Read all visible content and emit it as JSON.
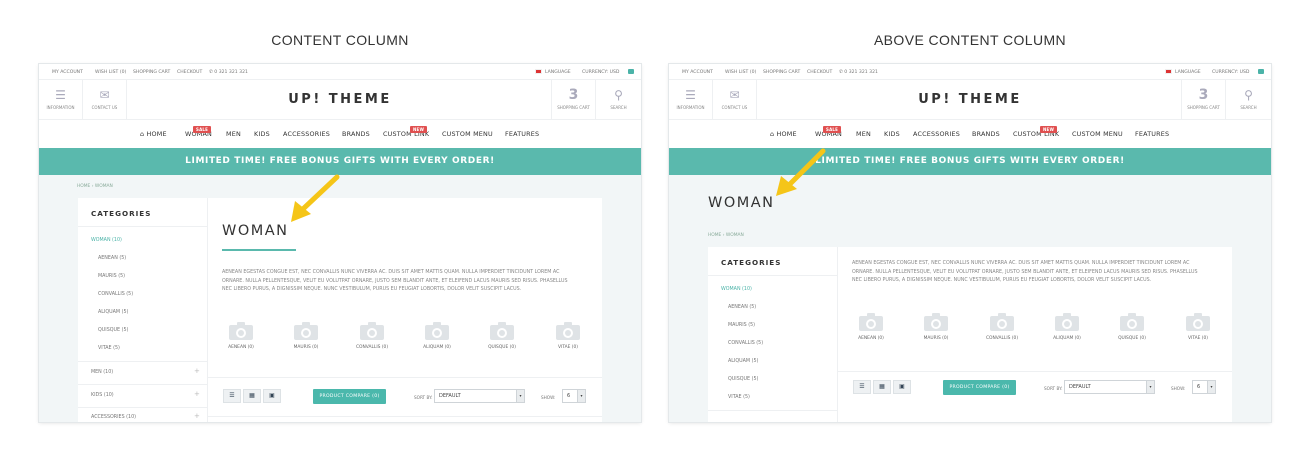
{
  "panels": {
    "left_title": "CONTENT COLUMN",
    "right_title": "ABOVE CONTENT COLUMN"
  },
  "topbar": {
    "my_account": "MY ACCOUNT",
    "wishlist": "WISH LIST (0)",
    "cart": "SHOPPING CART",
    "checkout": "CHECKOUT",
    "phone": "✆ 0 321 321 321",
    "language": "LANGUAGE",
    "currency": "CURRENCY: USD"
  },
  "header": {
    "information": "INFORMATION",
    "contact": "CONTACT US",
    "logo": "UP! THEME",
    "cart_count": "3",
    "cart_label": "SHOPPING CART",
    "search_label": "SEARCH"
  },
  "nav": {
    "home": "HOME",
    "woman": "WOMAN",
    "men": "MEN",
    "kids": "KIDS",
    "accessories": "ACCESSORIES",
    "brands": "BRANDS",
    "custom_link": "CUSTOM LINK",
    "custom_menu": "CUSTOM MENU",
    "features": "FEATURES",
    "sale_badge": "SALE",
    "new_badge": "NEW"
  },
  "banner": "LIMITED TIME! FREE BONUS GIFTS WITH EVERY ORDER!",
  "breadcrumb": {
    "home": "HOME",
    "sep": "›",
    "current": "WOMAN"
  },
  "page_heading": "WOMAN",
  "categories": {
    "title": "CATEGORIES",
    "active": "WOMAN (10)",
    "subs": [
      "AENEAN (5)",
      "MAURIS (5)",
      "CONVALLIS (5)",
      "ALIQUAM (5)",
      "QUISQUE (5)",
      "VITAE (5)"
    ],
    "men": "MEN (10)",
    "kids": "KIDS (10)",
    "accessories": "ACCESSORIES (10)",
    "plus": "+"
  },
  "description": {
    "line1": "AENEAN EGESTAS CONGUE EST, NEC CONVALLIS NUNC VIVERRA AC. DUIS SIT AMET MATTIS QUAM. NULLA IMPERDIET TINCIDUNT LOREM AC",
    "line2": "ORNARE. NULLA PELLENTESQUE, VELIT EU VOLUTPAT ORNARE, JUSTO SEM BLANDIT ANTE, ET ELEIFEND LACUS MAURIS SED RISUS. PHASELLUS",
    "line3": "NEC LIBERO PURUS, A DIGNISSIM NEQUE. NUNC VESTIBULUM, PURUS EU FEUGIAT LOBORTIS, DOLOR VELIT SUSCIPIT LACUS."
  },
  "subcategories": [
    "AENEAN (0)",
    "MAURIS (0)",
    "CONVALLIS (0)",
    "ALIQUAM (0)",
    "QUISQUE (0)",
    "VITAE (0)"
  ],
  "toolbar": {
    "compare": "PRODUCT COMPARE (0)",
    "sort_label": "SORT BY:",
    "sort_value": "DEFAULT",
    "show_label": "SHOW:",
    "show_value": "6",
    "dropdown": "▾"
  },
  "colors": {
    "accent": "#5ab9ad",
    "arrow": "#f5c518",
    "badge": "#e05050"
  }
}
